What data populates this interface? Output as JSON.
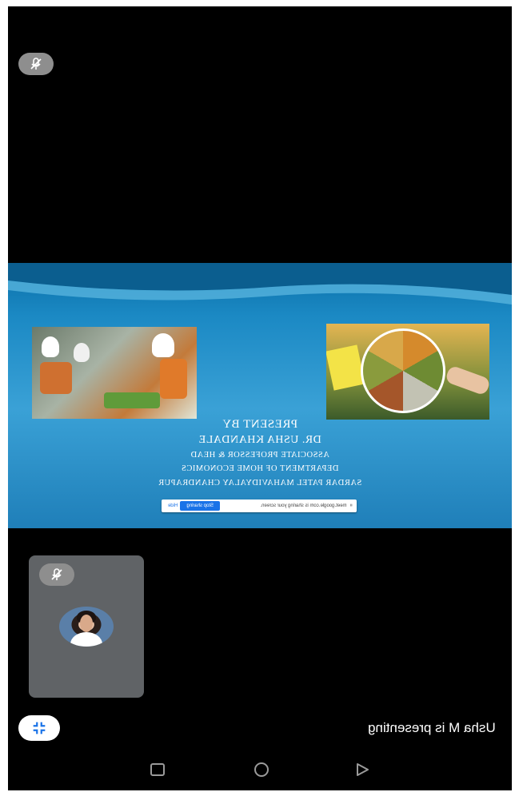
{
  "status": {
    "presenting_text": "Usha M is presenting"
  },
  "slide": {
    "present_by": "PRESENT BY",
    "presenter_name": "DR. USHA KHANDALE",
    "line1": "ASSOCIATE PROFESSOR & HEAD",
    "line2": "DEPARTMENT OF HOME ECONOMICS",
    "line3": "SARDAR PATEL MAHAVIDYALAY CHANDRAPUR",
    "share_bar": {
      "message": "meet.google.com is sharing your screen.",
      "stop_label": "Stop sharing",
      "hide_label": "Hide"
    }
  },
  "icons": {
    "mic_off": "mic-off-icon",
    "collapse": "collapse-icon",
    "recent": "recent-apps-icon",
    "home": "home-icon",
    "back": "back-icon"
  },
  "colors": {
    "slide_blue": "#1b89c4",
    "stop_button": "#1a73e8",
    "tile_gray": "#606366"
  }
}
